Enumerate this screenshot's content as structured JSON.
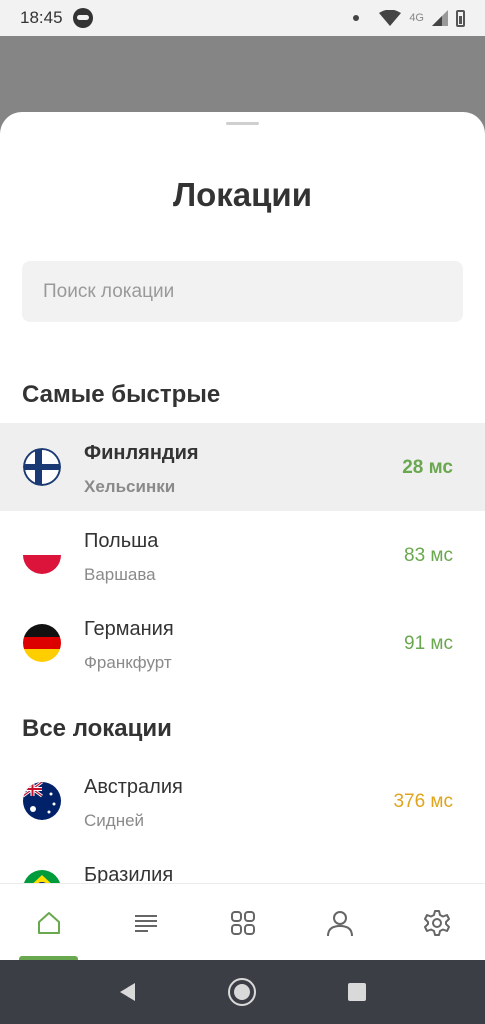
{
  "status_bar": {
    "time": "18:45",
    "network": "4G"
  },
  "sheet": {
    "title": "Локации"
  },
  "search": {
    "placeholder": "Поиск локации",
    "value": ""
  },
  "fastest": {
    "title": "Самые быстрые",
    "items": [
      {
        "country": "Финляндия",
        "city": "Хельсинки",
        "ping": "28 мс",
        "flag": "finland-flag",
        "selected": true
      },
      {
        "country": "Польша",
        "city": "Варшава",
        "ping": "83 мс",
        "flag": "poland-flag",
        "selected": false
      },
      {
        "country": "Германия",
        "city": "Франкфурт",
        "ping": "91 мс",
        "flag": "germany-flag",
        "selected": false
      }
    ]
  },
  "all": {
    "title": "Все локации",
    "items": [
      {
        "country": "Австралия",
        "city": "Сидней",
        "ping": "376 мс",
        "flag": "australia-flag"
      },
      {
        "country": "Бразилия",
        "city": "",
        "ping": "",
        "flag": "brazil-flag"
      }
    ]
  },
  "tabs": [
    {
      "icon": "home-icon",
      "active": true
    },
    {
      "icon": "list-icon",
      "active": false
    },
    {
      "icon": "apps-grid-icon",
      "active": false
    },
    {
      "icon": "profile-icon",
      "active": false
    },
    {
      "icon": "settings-gear-icon",
      "active": false
    }
  ],
  "colors": {
    "accent": "#6aa84f",
    "ping_fast": "#6aa84f",
    "ping_medium": "#e0a51c",
    "text": "#333333",
    "nav_bar": "#3b3e44"
  }
}
